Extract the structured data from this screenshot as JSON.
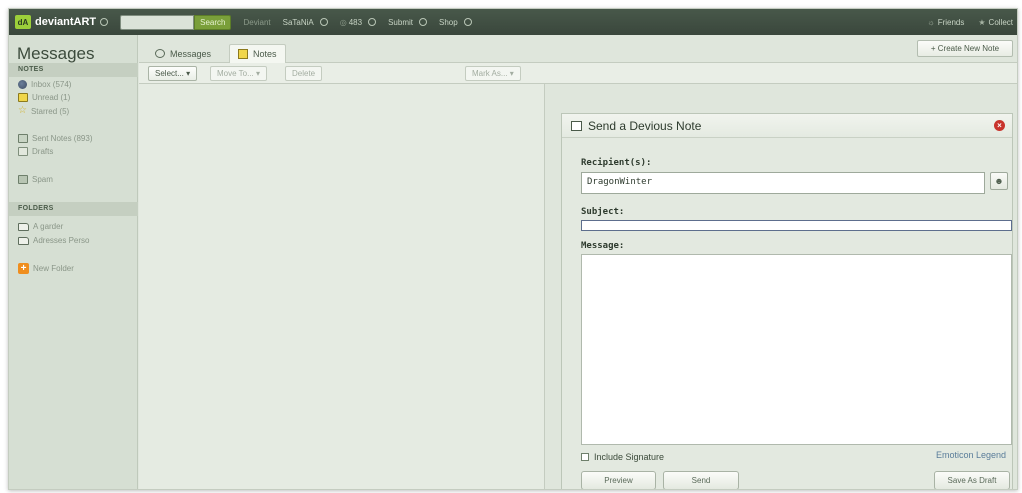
{
  "topbar": {
    "logo_text": "deviantART",
    "search_label": "Search",
    "deviant_label": "Deviant",
    "username": "SaTaNiA",
    "count": "483",
    "submit_label": "Submit",
    "shop_label": "Shop",
    "friends_label": "Friends",
    "collect_label": "Collect"
  },
  "sidebar": {
    "title": "Messages",
    "notes_header": "NOTES",
    "notes_items": [
      {
        "label": "Inbox (574)",
        "icon": "inbox-icon"
      },
      {
        "label": "Unread (1)",
        "icon": "unread-icon"
      },
      {
        "label": "Starred (5)",
        "icon": "star-icon"
      },
      {
        "label": "Sent Notes (893)",
        "icon": "sent-notes-icon"
      },
      {
        "label": "Drafts",
        "icon": "drafts-icon"
      },
      {
        "label": "Spam",
        "icon": "spam-icon"
      }
    ],
    "folders_header": "FOLDERS",
    "folders": [
      {
        "label": "A garder",
        "icon": "folder-icon"
      },
      {
        "label": "Adresses Perso",
        "icon": "folder-icon"
      }
    ],
    "new_folder_label": "New Folder"
  },
  "tabs": [
    {
      "label": "Messages",
      "icon": "message-icon",
      "active": false
    },
    {
      "label": "Notes",
      "icon": "note-icon",
      "active": true
    }
  ],
  "create_note_label": "+ Create New Note",
  "toolbar": {
    "select_label": "Select... ▾",
    "move_label": "Move To... ▾",
    "delete_label": "Delete",
    "mark_label": "Mark As... ▾"
  },
  "compose": {
    "title": "Send a Devious Note",
    "recipient_label": "Recipient(s):",
    "recipient_value": "DragonWinter",
    "subject_label": "Subject:",
    "subject_value": "",
    "message_label": "Message:",
    "message_value": "",
    "include_signature_label": "Include Signature",
    "emoticon_legend_label": "Emoticon Legend",
    "preview_label": "Preview",
    "send_label": "Send",
    "save_draft_label": "Save As Draft"
  },
  "colors": {
    "topbar": "#3f4d41",
    "accent_green": "#7a9f3a",
    "panel_bg": "#dfe6dc",
    "link_blue": "#5a7d9a",
    "close_red": "#c8342c"
  }
}
